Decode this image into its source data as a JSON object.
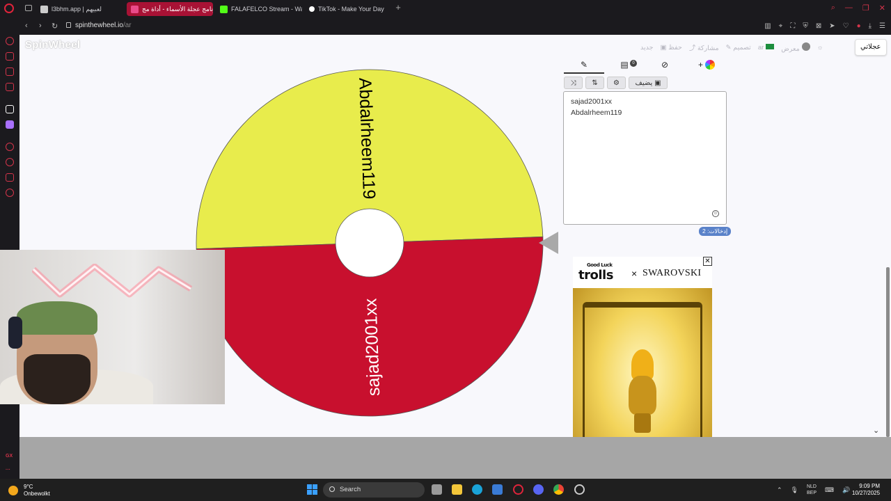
{
  "browser": {
    "tabs": [
      {
        "label": "l3bhm.app | لعبيهم",
        "active": false,
        "favicon_color": "#cccccc"
      },
      {
        "label": "برنامج عجلة الأسماء - أداة مج",
        "active": true,
        "favicon_color": "#e94b8a"
      },
      {
        "label": "FALAFELCO Stream - Wat",
        "active": false,
        "favicon_color": "#53fc18"
      },
      {
        "label": "TikTok - Make Your Day",
        "active": false,
        "favicon_color": "#ffffff"
      }
    ],
    "url_host": "spinthewheel.io",
    "url_path": "/ar"
  },
  "site": {
    "logo": "SpinWheel",
    "nav": {
      "new": "جديد",
      "save": "حفظ",
      "share": "مشاركة",
      "customize": "تصميم",
      "lang": "ar",
      "gallery": "معرض",
      "urgent": "عجلاتي"
    }
  },
  "panel": {
    "add_button": "يضيف",
    "entries": [
      "sajad2001xx",
      "Abdalrheem119"
    ],
    "count_label": "إدخالات: 2"
  },
  "wheel": {
    "segments": [
      {
        "label": "Abdalrheem119",
        "color": "#e8ec4c",
        "text_color": "#000000"
      },
      {
        "label": "sajad2001xx",
        "color": "#c8102e",
        "text_color": "#ffffff"
      }
    ],
    "rotation_deg": -2
  },
  "ad": {
    "brand_top": "Good Luck",
    "brand": "trolls",
    "x": "×",
    "partner": "SWAROVSKI",
    "close": "✕"
  },
  "taskbar": {
    "temp": "9°C",
    "weather": "Onbewolkt",
    "search": "Search",
    "lang_top": "NLD",
    "lang_bottom": "BEP",
    "time": "9:09 PM",
    "date": "10/27/2025"
  },
  "colors": {
    "accent": "#d4344a",
    "wheel_yellow": "#e8ec4c",
    "wheel_red": "#c8102e"
  }
}
